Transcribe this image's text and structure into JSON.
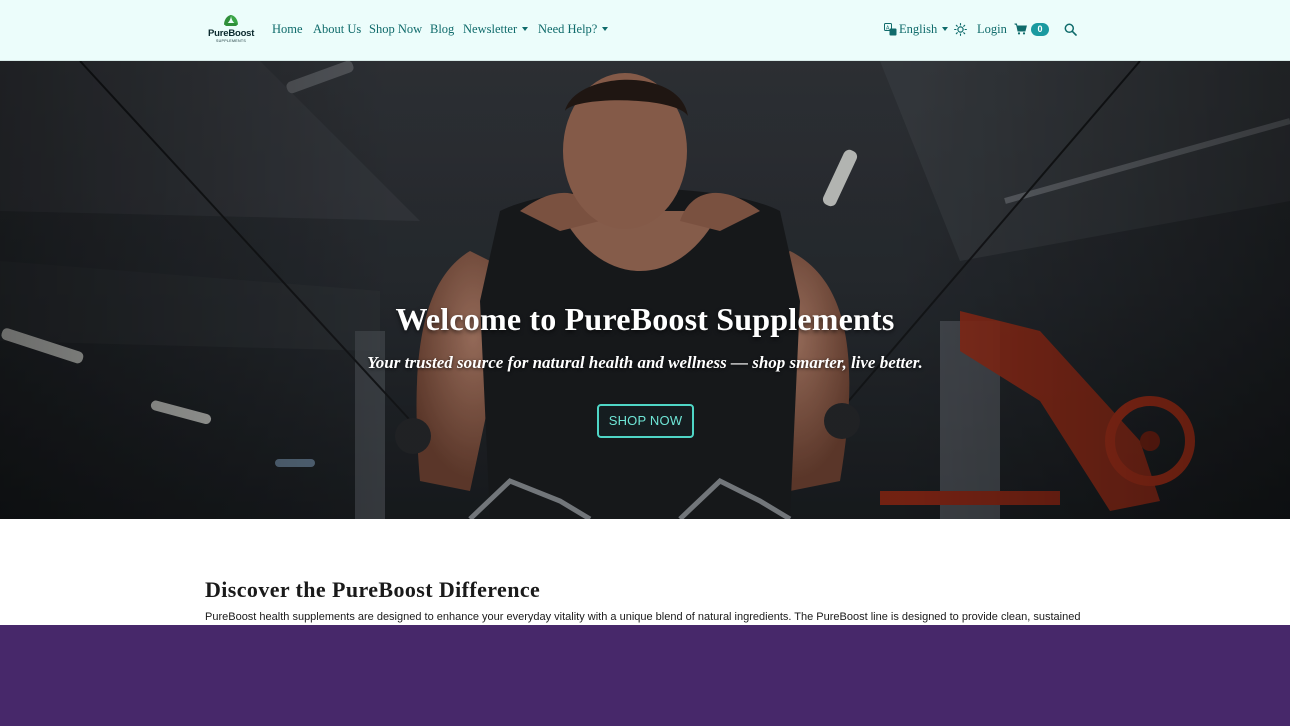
{
  "brand": {
    "name": "PureBoost",
    "tagline": "SUPPLEMENTS"
  },
  "nav": {
    "items": [
      {
        "label": "Home"
      },
      {
        "label": "About Us"
      },
      {
        "label": "Shop Now"
      },
      {
        "label": "Blog"
      },
      {
        "label": "Newsletter"
      },
      {
        "label": "Need Help?"
      }
    ],
    "language": "English",
    "login": "Login",
    "cart_count": "0"
  },
  "hero": {
    "title": "Welcome to PureBoost Supplements",
    "subtitle": "Your trusted source for natural health and wellness — shop smarter, live better.",
    "button": "SHOP NOW"
  },
  "section": {
    "title": "Discover the PureBoost Difference",
    "text": "PureBoost health supplements are designed to enhance your everyday vitality with a unique blend of natural ingredients. The PureBoost line is designed to provide clean, sustained"
  },
  "colors": {
    "navbar_bg": "#ecfdfb",
    "nav_text": "#0f6b6b",
    "accent": "#4fd6c6",
    "badge": "#1a9aa0",
    "footer_band": "#47286a"
  },
  "icons": {
    "language": "translate-icon",
    "theme": "sun-icon",
    "cart": "cart-icon",
    "search": "search-icon"
  }
}
